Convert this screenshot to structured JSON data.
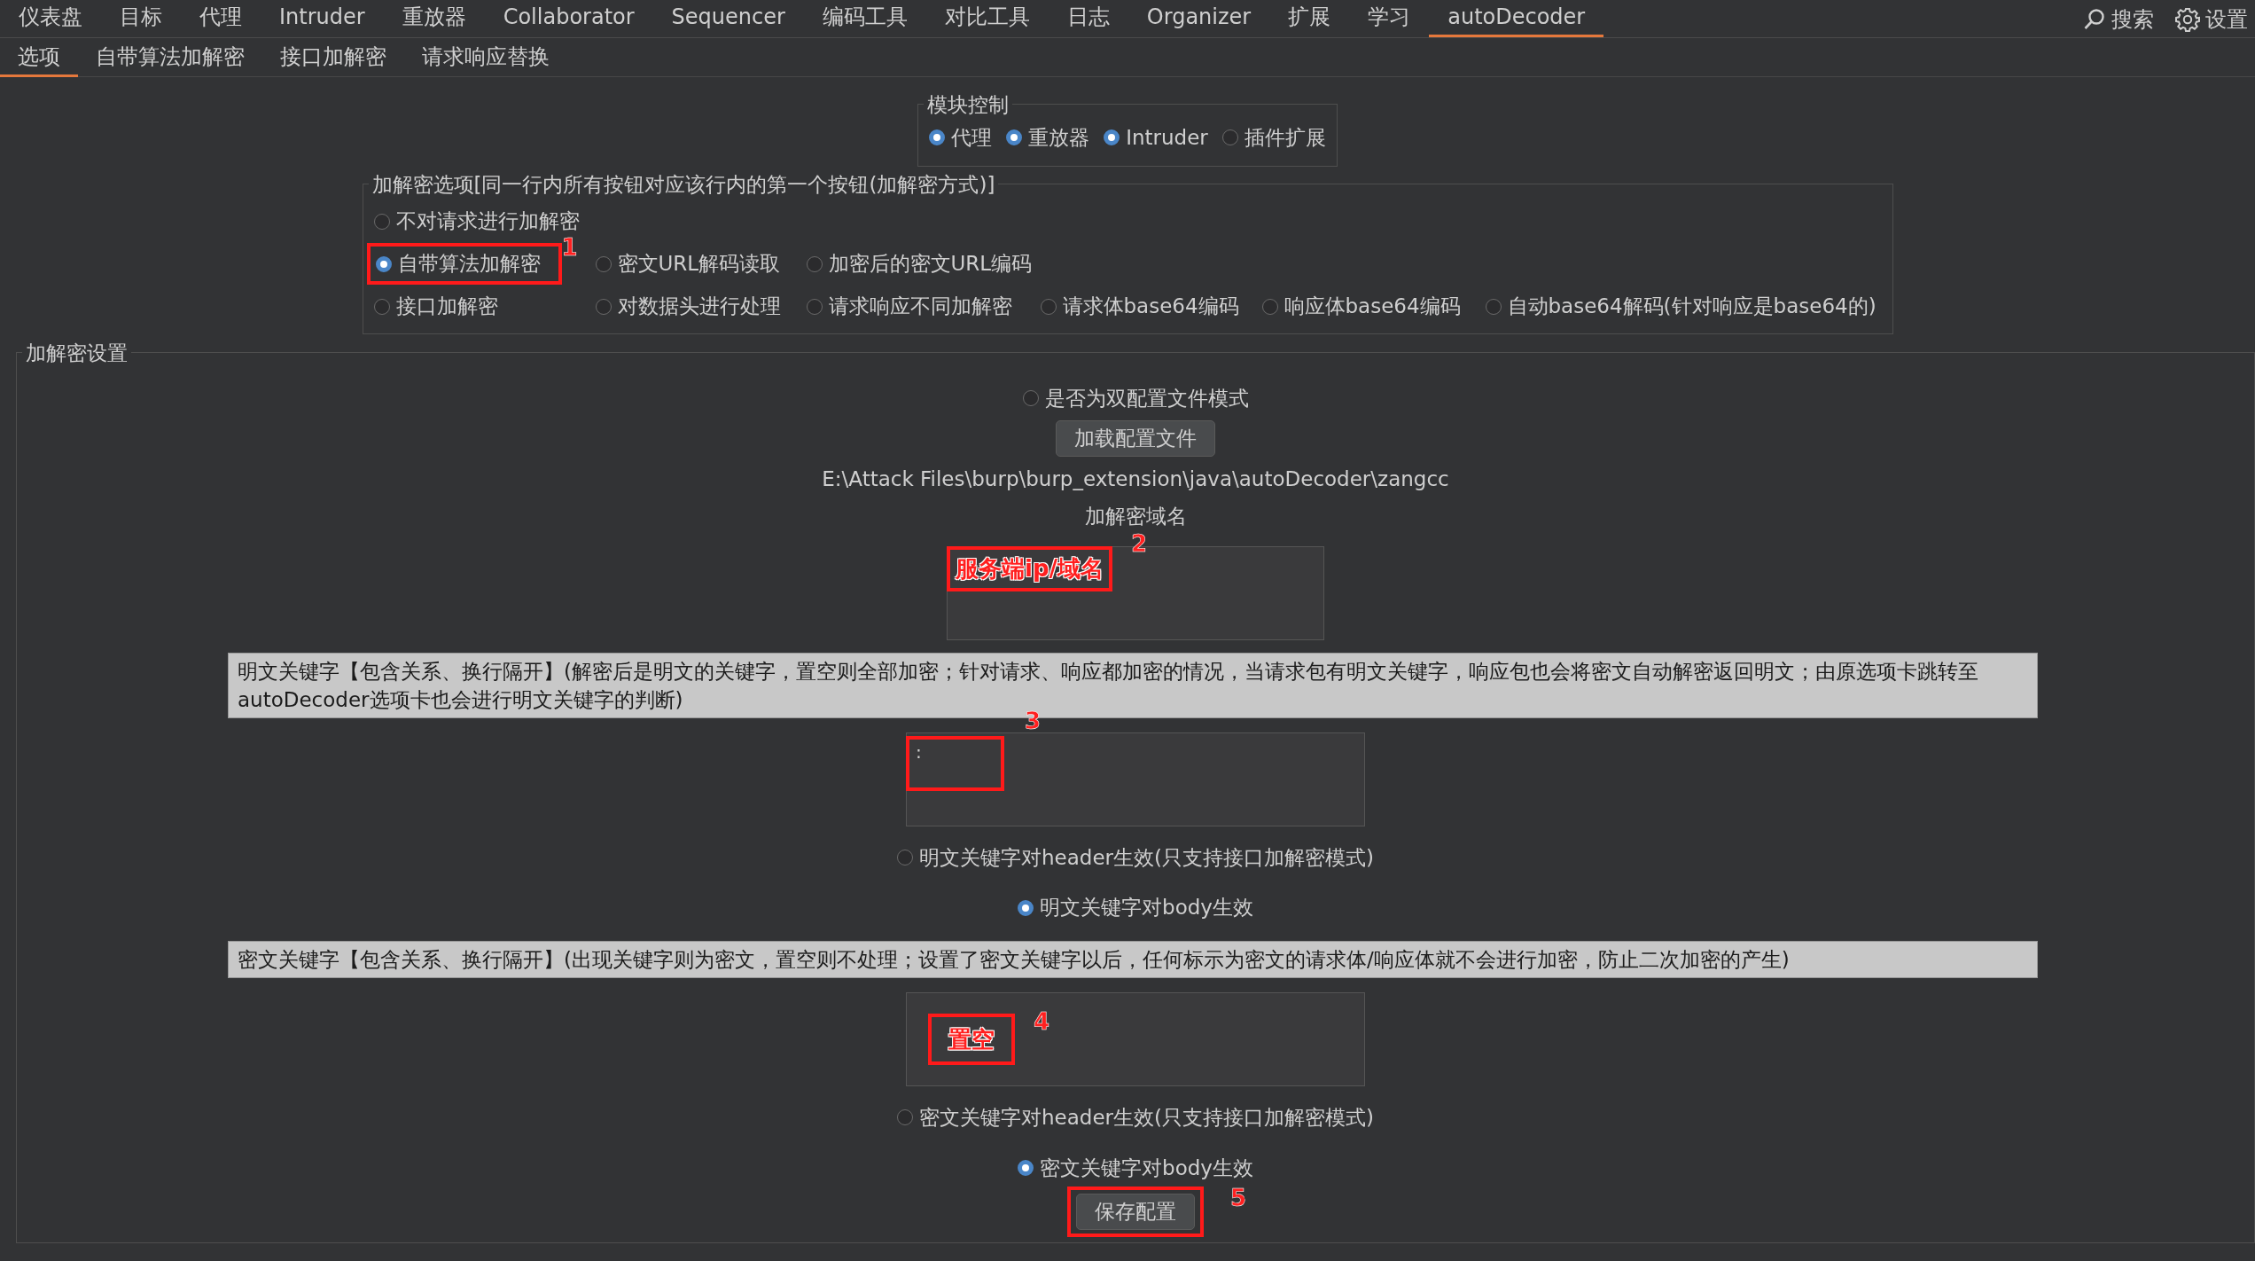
{
  "top_tabs": [
    {
      "label": "仪表盘",
      "selected": false
    },
    {
      "label": "目标",
      "selected": false
    },
    {
      "label": "代理",
      "selected": false
    },
    {
      "label": "Intruder",
      "selected": false
    },
    {
      "label": "重放器",
      "selected": false
    },
    {
      "label": "Collaborator",
      "selected": false
    },
    {
      "label": "Sequencer",
      "selected": false
    },
    {
      "label": "编码工具",
      "selected": false
    },
    {
      "label": "对比工具",
      "selected": false
    },
    {
      "label": "日志",
      "selected": false
    },
    {
      "label": "Organizer",
      "selected": false
    },
    {
      "label": "扩展",
      "selected": false
    },
    {
      "label": "学习",
      "selected": false
    },
    {
      "label": "autoDecoder",
      "selected": true
    }
  ],
  "tools": [
    {
      "kind": "search",
      "label": "搜索"
    },
    {
      "kind": "settings",
      "label": "设置"
    }
  ],
  "sub_tabs": [
    {
      "label": "选项",
      "selected": true
    },
    {
      "label": "自带算法加解密",
      "selected": false
    },
    {
      "label": "接口加解密",
      "selected": false
    },
    {
      "label": "请求响应替换",
      "selected": false
    }
  ],
  "module_control": {
    "title": "模块控制",
    "options": [
      {
        "label": "代理",
        "checked": true
      },
      {
        "label": "重放器",
        "checked": true
      },
      {
        "label": "Intruder",
        "checked": true
      },
      {
        "label": "插件扩展",
        "checked": false
      }
    ]
  },
  "crypto_options": {
    "title": "加解密选项[同一行内所有按钮对应该行内的第一个按钮(加解密方式)]",
    "rows": [
      [
        {
          "label": "不对请求进行加解密",
          "checked": false
        }
      ],
      [
        {
          "label": "自带算法加解密",
          "checked": true
        },
        {
          "label": "密文URL解码读取",
          "checked": false
        },
        {
          "label": "加密后的密文URL编码",
          "checked": false
        }
      ],
      [
        {
          "label": "接口加解密",
          "checked": false
        },
        {
          "label": "对数据头进行处理",
          "checked": false
        },
        {
          "label": "请求响应不同加解密",
          "checked": false
        },
        {
          "label": "请求体base64编码",
          "checked": false
        },
        {
          "label": "响应体base64编码",
          "checked": false
        },
        {
          "label": "自动base64解码(针对响应是base64的)",
          "checked": false
        }
      ]
    ]
  },
  "settings": {
    "title": "加解密设置",
    "dual_config": {
      "label": "是否为双配置文件模式",
      "checked": false
    },
    "load_button": "加载配置文件",
    "config_path": "E:\\Attack Files\\burp\\burp_extension\\java\\autoDecoder\\zangcc",
    "domain_label": "加解密域名",
    "plaintext_note": "明文关键字【包含关系、换行隔开】(解密后是明文的关键字，置空则全部加密；针对请求、响应都加密的情况，当请求包有明文关键字，响应包也会将密文自动解密返回明文；由原选项卡跳转至autoDecoder选项卡也会进行明文关键字的判断)",
    "plaintext_field": {
      "value": ":"
    },
    "plaintext_scope": [
      {
        "label": "明文关键字对header生效(只支持接口加解密模式)",
        "checked": false
      },
      {
        "label": "明文关键字对body生效",
        "checked": true
      }
    ],
    "ciphertext_note": "密文关键字【包含关系、换行隔开】(出现关键字则为密文，置空则不处理；设置了密文关键字以后，任何标示为密文的请求体/响应体就不会进行加密，防止二次加密的产生)",
    "ciphertext_scope": [
      {
        "label": "密文关键字对header生效(只支持接口加解密模式)",
        "checked": false
      },
      {
        "label": "密文关键字对body生效",
        "checked": true
      }
    ],
    "save_button": "保存配置"
  },
  "annotations": [
    {
      "number": "1"
    },
    {
      "number": "2",
      "text": "服务端ip/域名"
    },
    {
      "number": "3"
    },
    {
      "number": "4",
      "text": "置空"
    },
    {
      "number": "5"
    }
  ]
}
